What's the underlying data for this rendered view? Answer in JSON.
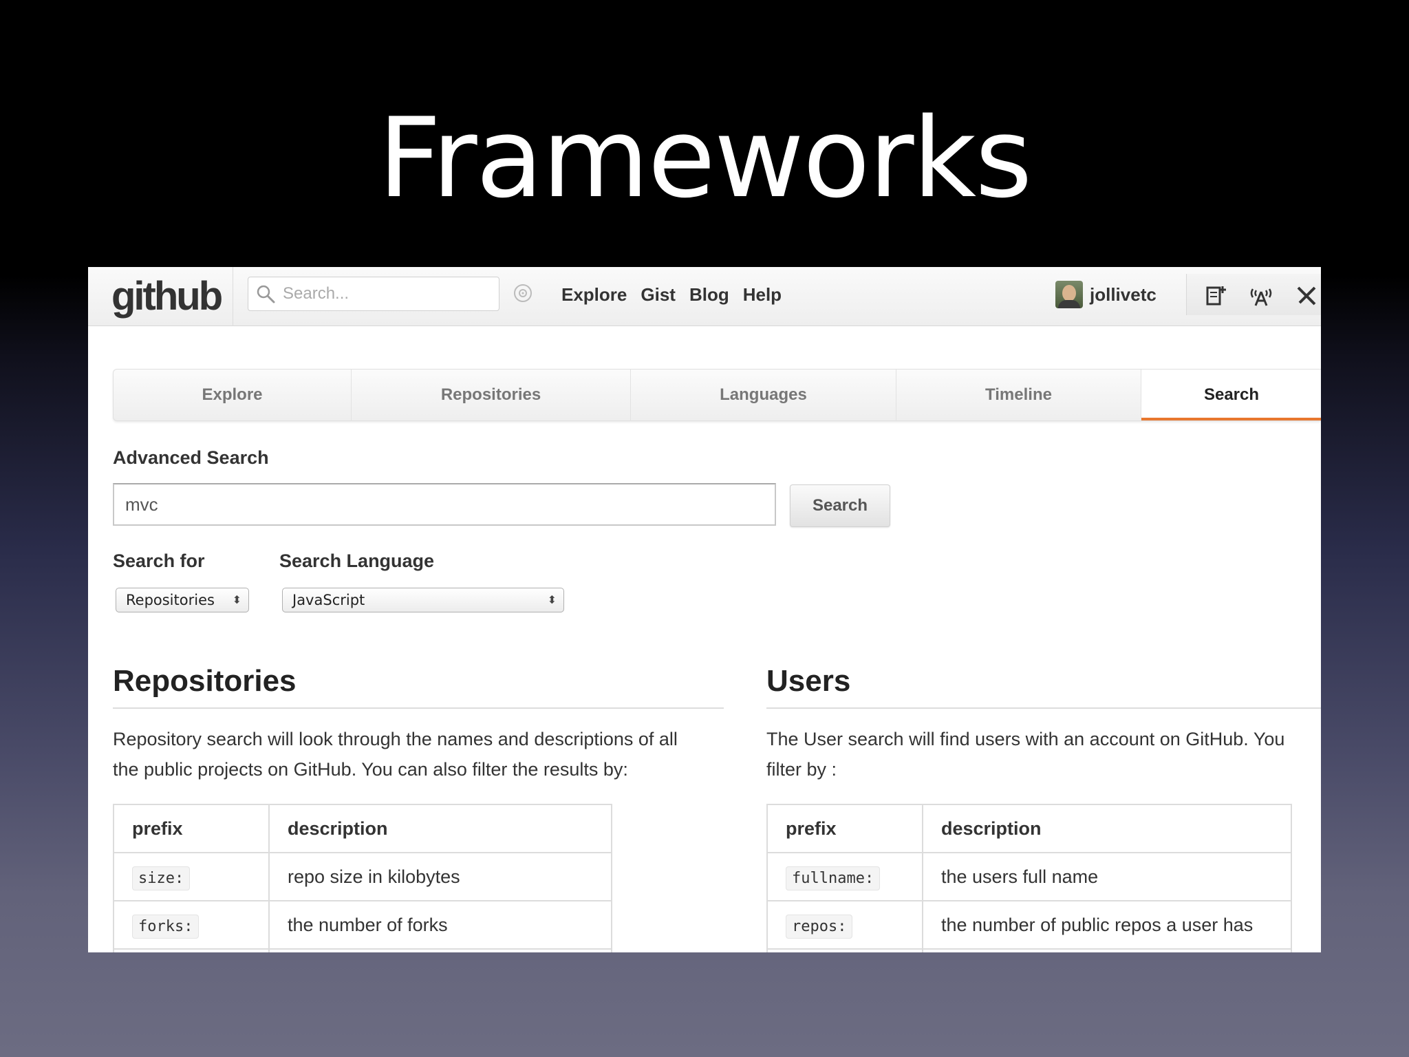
{
  "slide": {
    "title": "Frameworks"
  },
  "header": {
    "logo": "github",
    "search_placeholder": "Search...",
    "nav": [
      "Explore",
      "Gist",
      "Blog",
      "Help"
    ],
    "username": "jollivetc"
  },
  "tabs": [
    {
      "label": "Explore",
      "active": false
    },
    {
      "label": "Repositories",
      "active": false
    },
    {
      "label": "Languages",
      "active": false
    },
    {
      "label": "Timeline",
      "active": false
    },
    {
      "label": "Search",
      "active": true
    }
  ],
  "advanced": {
    "label": "Advanced Search",
    "query": "mvc",
    "button": "Search",
    "search_for_label": "Search for",
    "search_for_value": "Repositories",
    "language_label": "Search Language",
    "language_value": "JavaScript"
  },
  "repositories": {
    "title": "Repositories",
    "desc_line1": "Repository search will look through the names and descriptions of all",
    "desc_line2": "the public projects on GitHub. You can also filter the results by:",
    "headers": [
      "prefix",
      "description"
    ],
    "rows": [
      {
        "prefix": "size:",
        "description": "repo size in kilobytes"
      },
      {
        "prefix": "forks:",
        "description": "the number of forks"
      }
    ]
  },
  "users": {
    "title": "Users",
    "desc_line1": "The User search will find users with an account on GitHub. You",
    "desc_line2": "filter by :",
    "headers": [
      "prefix",
      "description"
    ],
    "rows": [
      {
        "prefix": "fullname:",
        "description": "the users full name"
      },
      {
        "prefix": "repos:",
        "description": "the number of public repos a user has"
      }
    ]
  },
  "colors": {
    "tab_active_accent": "#e8772e"
  }
}
